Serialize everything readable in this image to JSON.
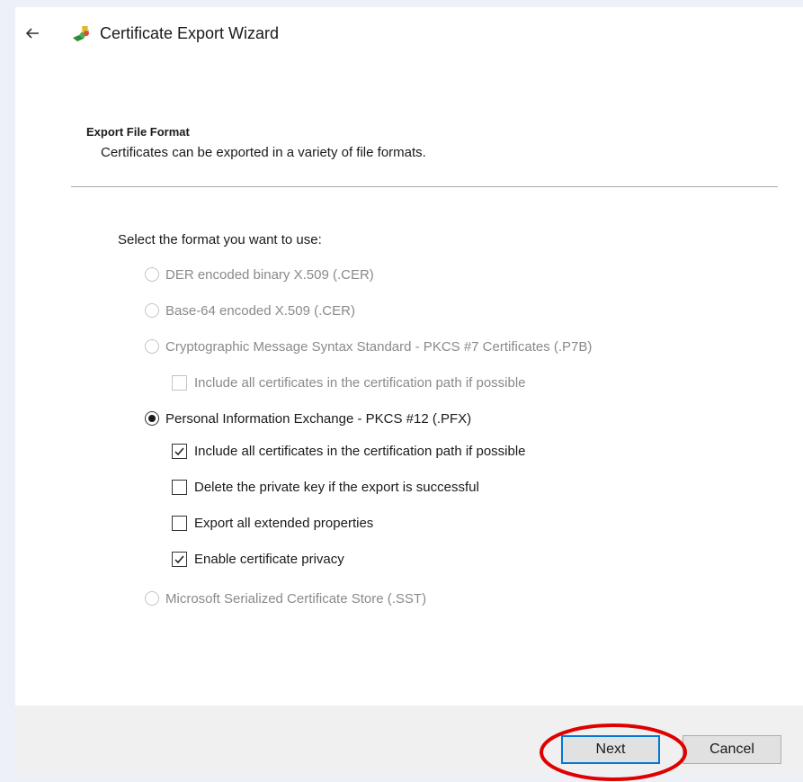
{
  "wizard": {
    "title": "Certificate Export Wizard",
    "back_icon": "back-arrow-icon",
    "app_icon": "certificate-icon"
  },
  "section": {
    "heading": "Export File Format",
    "description": "Certificates can be exported in a variety of file formats."
  },
  "format": {
    "prompt": "Select the format you want to use:",
    "options": [
      {
        "label": "DER encoded binary X.509 (.CER)",
        "type": "radio",
        "checked": false,
        "enabled": false
      },
      {
        "label": "Base-64 encoded X.509 (.CER)",
        "type": "radio",
        "checked": false,
        "enabled": false
      },
      {
        "label": "Cryptographic Message Syntax Standard - PKCS #7 Certificates (.P7B)",
        "type": "radio",
        "checked": false,
        "enabled": false
      },
      {
        "label": "Include all certificates in the certification path if possible",
        "type": "checkbox",
        "checked": false,
        "enabled": false
      },
      {
        "label": "Personal Information Exchange - PKCS #12 (.PFX)",
        "type": "radio",
        "checked": true,
        "enabled": true
      },
      {
        "label": "Include all certificates in the certification path if possible",
        "type": "checkbox",
        "checked": true,
        "enabled": true
      },
      {
        "label": "Delete the private key if the export is successful",
        "type": "checkbox",
        "checked": false,
        "enabled": true
      },
      {
        "label": "Export all extended properties",
        "type": "checkbox",
        "checked": false,
        "enabled": true
      },
      {
        "label": "Enable certificate privacy",
        "type": "checkbox",
        "checked": true,
        "enabled": true
      },
      {
        "label": "Microsoft Serialized Certificate Store (.SST)",
        "type": "radio",
        "checked": false,
        "enabled": false
      }
    ]
  },
  "buttons": {
    "next": "Next",
    "cancel": "Cancel"
  },
  "colors": {
    "highlight": "#e00000",
    "focus_border": "#0078d7",
    "disabled_text": "#8a8a8a"
  }
}
